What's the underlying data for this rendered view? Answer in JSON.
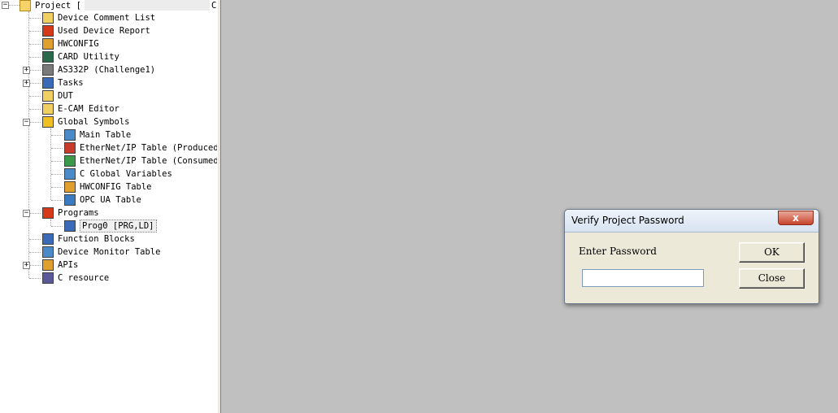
{
  "tree": {
    "root_label": "Project [",
    "root_suffix": "C",
    "items": [
      {
        "label": "Device Comment List",
        "icon": "comment-list-icon"
      },
      {
        "label": "Used Device Report",
        "icon": "report-icon"
      },
      {
        "label": "HWCONFIG",
        "icon": "hwconfig-icon"
      },
      {
        "label": "CARD Utility",
        "icon": "card-icon"
      },
      {
        "label": "AS332P  (Challenge1)",
        "icon": "plc-icon"
      },
      {
        "label": "Tasks",
        "icon": "tasks-icon"
      },
      {
        "label": "DUT",
        "icon": "dut-icon"
      },
      {
        "label": "E-CAM Editor",
        "icon": "ecam-icon"
      },
      {
        "label": "Global Symbols",
        "icon": "globe-icon"
      },
      {
        "label": "Main Table",
        "icon": "table-icon"
      },
      {
        "label": "EtherNet/IP Table (Produced",
        "icon": "ethernet-produced-icon"
      },
      {
        "label": "EtherNet/IP Table (Consumed",
        "icon": "ethernet-consumed-icon"
      },
      {
        "label": "C Global Variables",
        "icon": "variables-icon"
      },
      {
        "label": "HWCONFIG Table",
        "icon": "hwconfig-table-icon"
      },
      {
        "label": "OPC UA Table",
        "icon": "opcua-icon"
      },
      {
        "label": "Programs",
        "icon": "programs-icon"
      },
      {
        "label": "Prog0 [PRG,LD]",
        "icon": "ladder-program-icon"
      },
      {
        "label": "Function Blocks",
        "icon": "function-blocks-icon"
      },
      {
        "label": "Device Monitor Table",
        "icon": "monitor-icon"
      },
      {
        "label": "APIs",
        "icon": "apis-icon"
      },
      {
        "label": "C resource",
        "icon": "resource-icon"
      }
    ]
  },
  "dialog": {
    "title": "Verify Project Password",
    "close_glyph": "x",
    "password_label": "Enter Password",
    "password_value": "",
    "ok_label": "OK",
    "close_label": "Close"
  },
  "colors": {
    "workspace": "#c0c0c0",
    "dialog_bg": "#ece9d8",
    "close_button": "#c8442c"
  }
}
